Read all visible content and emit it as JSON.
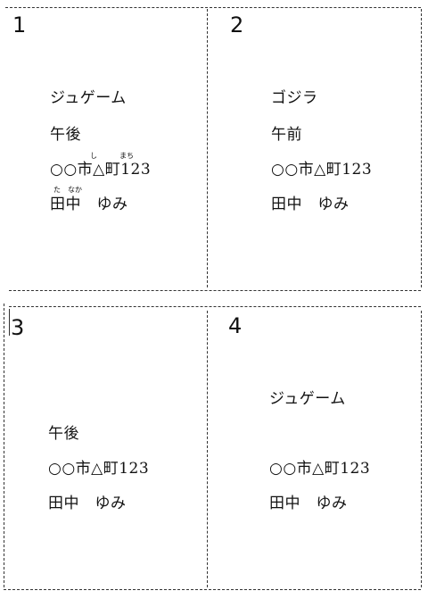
{
  "cards": [
    {
      "number": "1",
      "lines": [
        "ジュゲーム",
        "午後",
        "○○市△町123",
        "田中　ゆみ"
      ],
      "ruby": {
        "shi": "し",
        "machi": "まち",
        "ta": "た",
        "naka": "なか"
      }
    },
    {
      "number": "2",
      "lines": [
        "ゴジラ",
        "午前",
        "○○市△町123",
        "田中　ゆみ"
      ]
    },
    {
      "number": "3",
      "lines": [
        "午後",
        "○○市△町123",
        "田中　ゆみ"
      ]
    },
    {
      "number": "4",
      "lines": [
        "ジュゲーム",
        "○○市△町123",
        "田中　ゆみ"
      ]
    }
  ]
}
